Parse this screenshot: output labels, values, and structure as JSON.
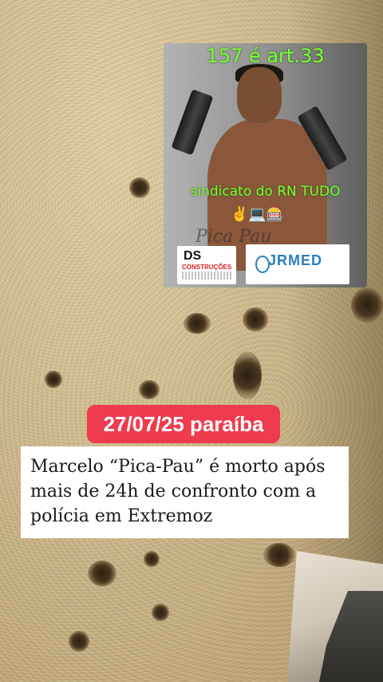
{
  "inset_photo": {
    "caption_top": "157 é art.33",
    "caption_mid": "sindicato do RN TUDO",
    "emoji_row": "✌️💻🎰",
    "overlay_name": "Pica Pau",
    "logos": {
      "ds_mark": "DS",
      "ds_text": "CONSTRUÇÕES",
      "jr_mark": "JRMED"
    }
  },
  "date_badge": "27/07/25 paraíba",
  "headline": "Marcelo “Pica-Pau” é morto após mais de 24h de confronto com a polícia em Extremoz",
  "colors": {
    "badge": "#ef3b4e",
    "caption_green": "#7cff3a",
    "headline_bg": "#ffffff"
  }
}
